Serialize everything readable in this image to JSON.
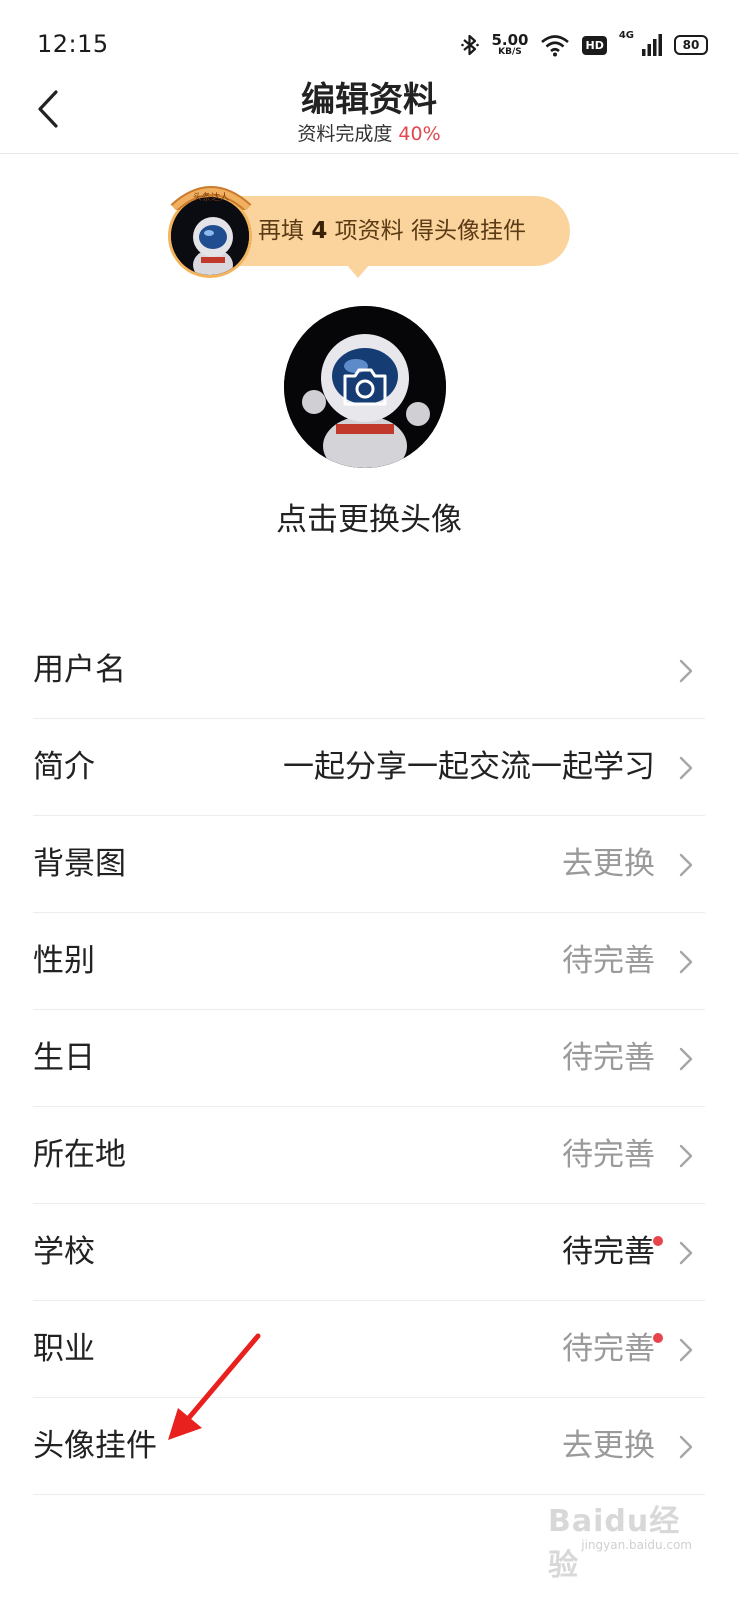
{
  "status_bar": {
    "time": "12:15",
    "net_speed_value": "5.00",
    "net_speed_unit": "KB/S",
    "hd_label": "HD",
    "signal_label": "4G",
    "battery": "80",
    "icons": [
      "bluetooth-icon",
      "wifi-icon",
      "signal-icon",
      "battery-icon"
    ]
  },
  "header": {
    "title": "编辑资料",
    "completion_label": "资料完成度",
    "completion_value": "40%",
    "completion_color": "#e0484f"
  },
  "reward_tip": {
    "prefix": "再填",
    "count": "4",
    "suffix": "项资料 得头像挂件",
    "pendant_text": "头条达人",
    "background": "#fbd49d"
  },
  "avatar": {
    "hint": "点击更换头像"
  },
  "profile_rows": [
    {
      "label": "用户名",
      "value": "",
      "muted": false,
      "badge": false
    },
    {
      "label": "简介",
      "value": "一起分享一起交流一起学习",
      "muted": false,
      "badge": false
    },
    {
      "label": "背景图",
      "value": "去更换",
      "muted": true,
      "badge": false
    },
    {
      "label": "性别",
      "value": "待完善",
      "muted": true,
      "badge": false
    },
    {
      "label": "生日",
      "value": "待完善",
      "muted": true,
      "badge": false
    },
    {
      "label": "所在地",
      "value": "待完善",
      "muted": true,
      "badge": false
    },
    {
      "label": "学校",
      "value": "待完善",
      "muted": false,
      "badge": true
    },
    {
      "label": "职业",
      "value": "待完善",
      "muted": true,
      "badge": true
    },
    {
      "label": "头像挂件",
      "value": "去更换",
      "muted": true,
      "badge": false
    }
  ],
  "watermark": {
    "main": "Baidu经验",
    "sub": "jingyan.baidu.com"
  }
}
